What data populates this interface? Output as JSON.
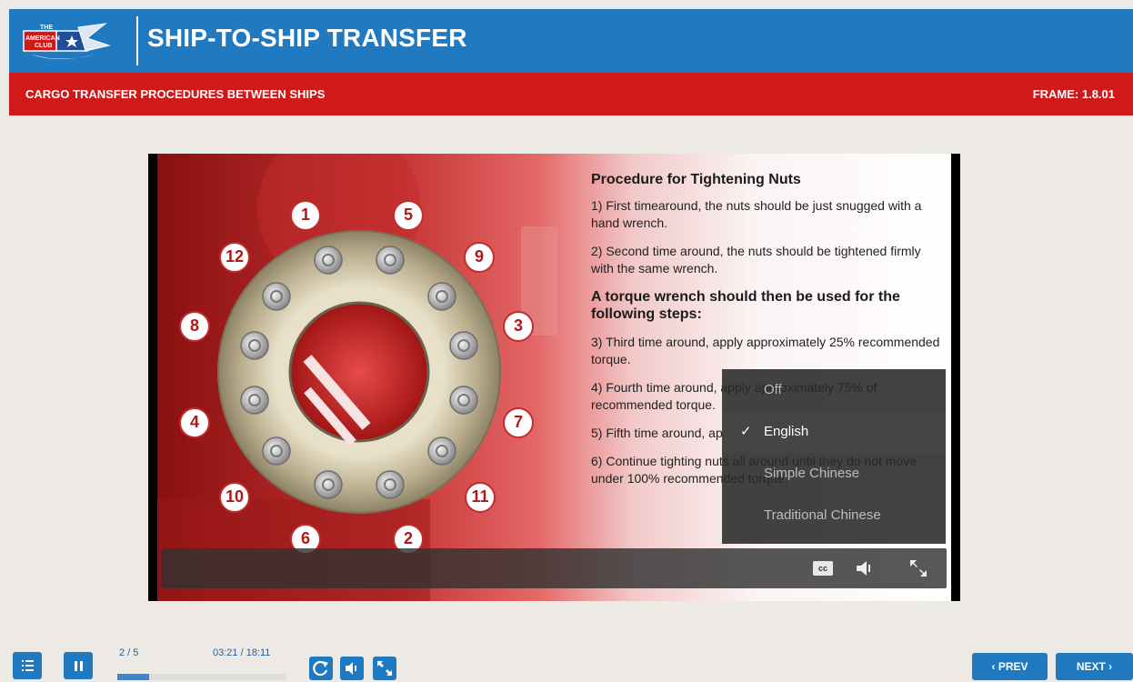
{
  "header": {
    "logo_text": "THE AMERICAN CLUB",
    "title": "SHIP-TO-SHIP TRANSFER"
  },
  "subheader": {
    "subtitle": "CARGO TRANSFER PROCEDURES BETWEEN SHIPS",
    "frame": "FRAME: 1.8.01"
  },
  "slide": {
    "heading": "Procedure for Tightening Nuts",
    "step1": "1) First timearound, the nuts should be just snugged with a hand wrench.",
    "step2": "2) Second time around, the nuts should be tightened firmly with the same wrench.",
    "subheading": "A torque wrench should then be used for the following steps:",
    "step3": "3) Third time around, apply approximately 25% recommended torque.",
    "step4": "4) Fourth time around, apply approximately 75% of recommended torque.",
    "step5": "5) Fifth time around, apply 100% of recommended torque.",
    "step6": "6) Continue tighting nuts all around until they do not move under 100% recommended torque.",
    "bolt_numbers": [
      "1",
      "5",
      "9",
      "3",
      "7",
      "11",
      "2",
      "6",
      "10",
      "4",
      "8",
      "12"
    ]
  },
  "captions_menu": {
    "options": [
      "Off",
      "English",
      "Simple Chinese",
      "Traditional Chinese"
    ],
    "selected": "English",
    "check": "✓"
  },
  "player": {
    "cc_label": "cc",
    "volume_icon": "volume-icon",
    "fullscreen_icon": "fullscreen-icon"
  },
  "bottom_bar": {
    "menu_icon": "menu-icon",
    "pause_icon": "pause-icon",
    "page": "2 / 5",
    "progress": 0.19,
    "time": "03:21 / 18:11",
    "replay_icon": "replay-icon",
    "volume_icon": "volume-icon",
    "fullscreen_icon": "fullscreen-icon",
    "prev_label": "‹ PREV",
    "next_label": "NEXT ›"
  },
  "colors": {
    "header_blue": "#1f7ac2",
    "subheader_red": "#d01a1a",
    "background": "#edeae5"
  }
}
